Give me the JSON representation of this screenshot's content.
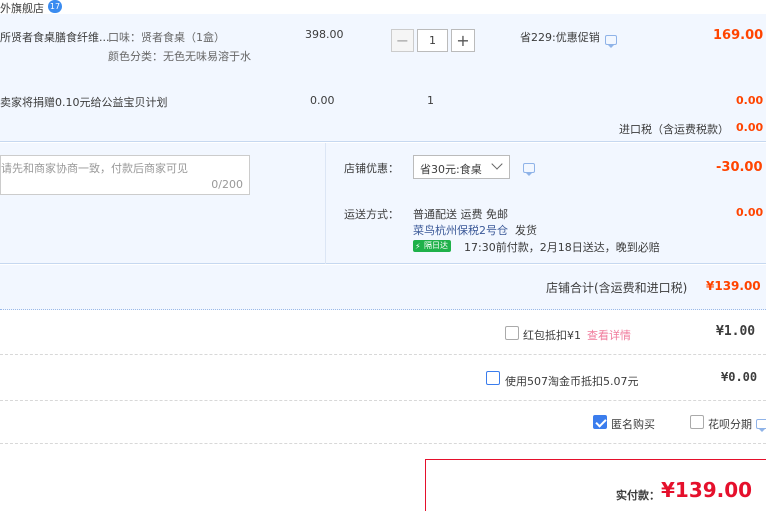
{
  "shop": {
    "name": "外旗舰店",
    "badge": "17"
  },
  "item": {
    "title": "所贤者食桌膳食纤维...",
    "sku_flavor": "口味：贤者食桌（1盒）",
    "sku_color": "颜色分类：无色无味易溶于水",
    "price": "398.00",
    "quantity": "1",
    "promo": "省229:优惠促销",
    "subtotal": "169.00"
  },
  "charity": {
    "text": "卖家将捐赠0.10元给公益宝贝计划",
    "price": "0.00",
    "quantity": "1",
    "subtotal": "0.00"
  },
  "import_tax": {
    "label": "进口税（含运费税款）",
    "value": "0.00"
  },
  "message": {
    "placeholder": "请先和商家协商一致，付款后商家可见",
    "counter": "0/200"
  },
  "shop_discount": {
    "label": "店铺优惠：",
    "selected": "省30元:食桌",
    "value": "-30.00"
  },
  "shipping": {
    "label": "运送方式：",
    "method": "普通配送 运费 免邮",
    "warehouse": "菜鸟杭州保税2号仓",
    "dispatch": "发货",
    "badge": "隔日达",
    "eta": "17:30前付款，2月18日送达，晚到必赔",
    "value": "0.00"
  },
  "shop_total": {
    "label": "店铺合计(含运费和进口税)",
    "value": "¥139.00"
  },
  "redpacket": {
    "label": "红包抵扣¥1",
    "link": "查看详情",
    "value": "¥1.00"
  },
  "taobao_coin": {
    "label": "使用507淘金币抵扣5.07元",
    "value": "¥0.00"
  },
  "options": {
    "anonymous": "匿名购买",
    "huabei": "花呗分期"
  },
  "pay": {
    "label": "实付款：",
    "amount": "¥139.00"
  },
  "colors": {
    "accent": "#ff4400",
    "pay_border": "#e5102c",
    "band_bg": "#f2f7ff"
  }
}
